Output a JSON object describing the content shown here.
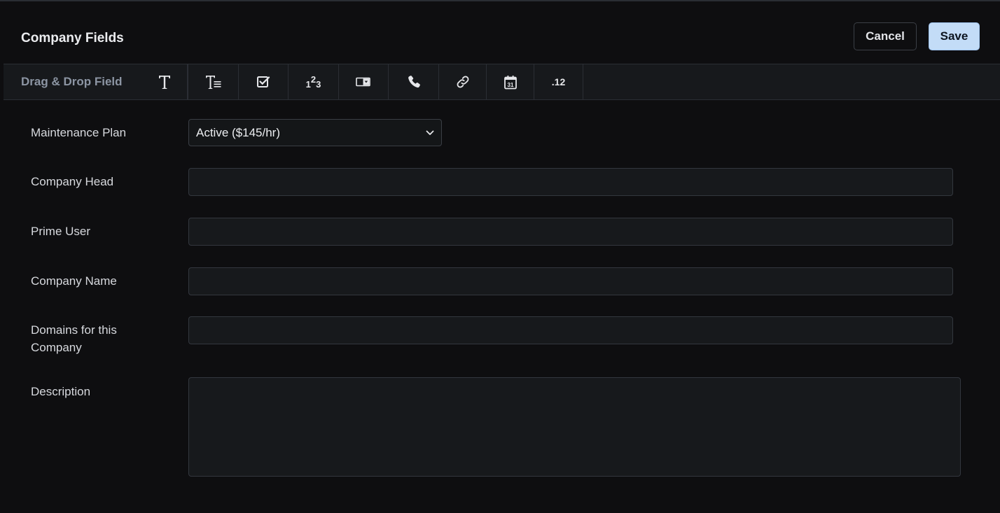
{
  "header": {
    "title": "Company Fields",
    "cancel_label": "Cancel",
    "save_label": "Save"
  },
  "toolbar": {
    "label": "Drag & Drop Field",
    "tools": [
      {
        "icon": "text-icon"
      },
      {
        "icon": "paragraph-text-icon"
      },
      {
        "icon": "checkbox-icon"
      },
      {
        "icon": "number-icon",
        "text": "123"
      },
      {
        "icon": "dropdown-icon"
      },
      {
        "icon": "phone-icon"
      },
      {
        "icon": "link-icon"
      },
      {
        "icon": "calendar-icon",
        "text": "31"
      },
      {
        "icon": "decimal-icon",
        "text": ".12"
      }
    ]
  },
  "form": {
    "maintenance_plan": {
      "label": "Maintenance Plan",
      "value": "Active ($145/hr)"
    },
    "company_head": {
      "label": "Company Head",
      "value": ""
    },
    "prime_user": {
      "label": "Prime User",
      "value": ""
    },
    "company_name": {
      "label": "Company Name",
      "value": ""
    },
    "domains": {
      "label": "Domains for this Company",
      "value": ""
    },
    "description": {
      "label": "Description",
      "value": ""
    }
  },
  "colors": {
    "background": "#0e0e10",
    "panel": "#17191c",
    "border": "#33373e",
    "save_button": "#c3dcf7",
    "toolbar_label": "#8c95a3"
  }
}
